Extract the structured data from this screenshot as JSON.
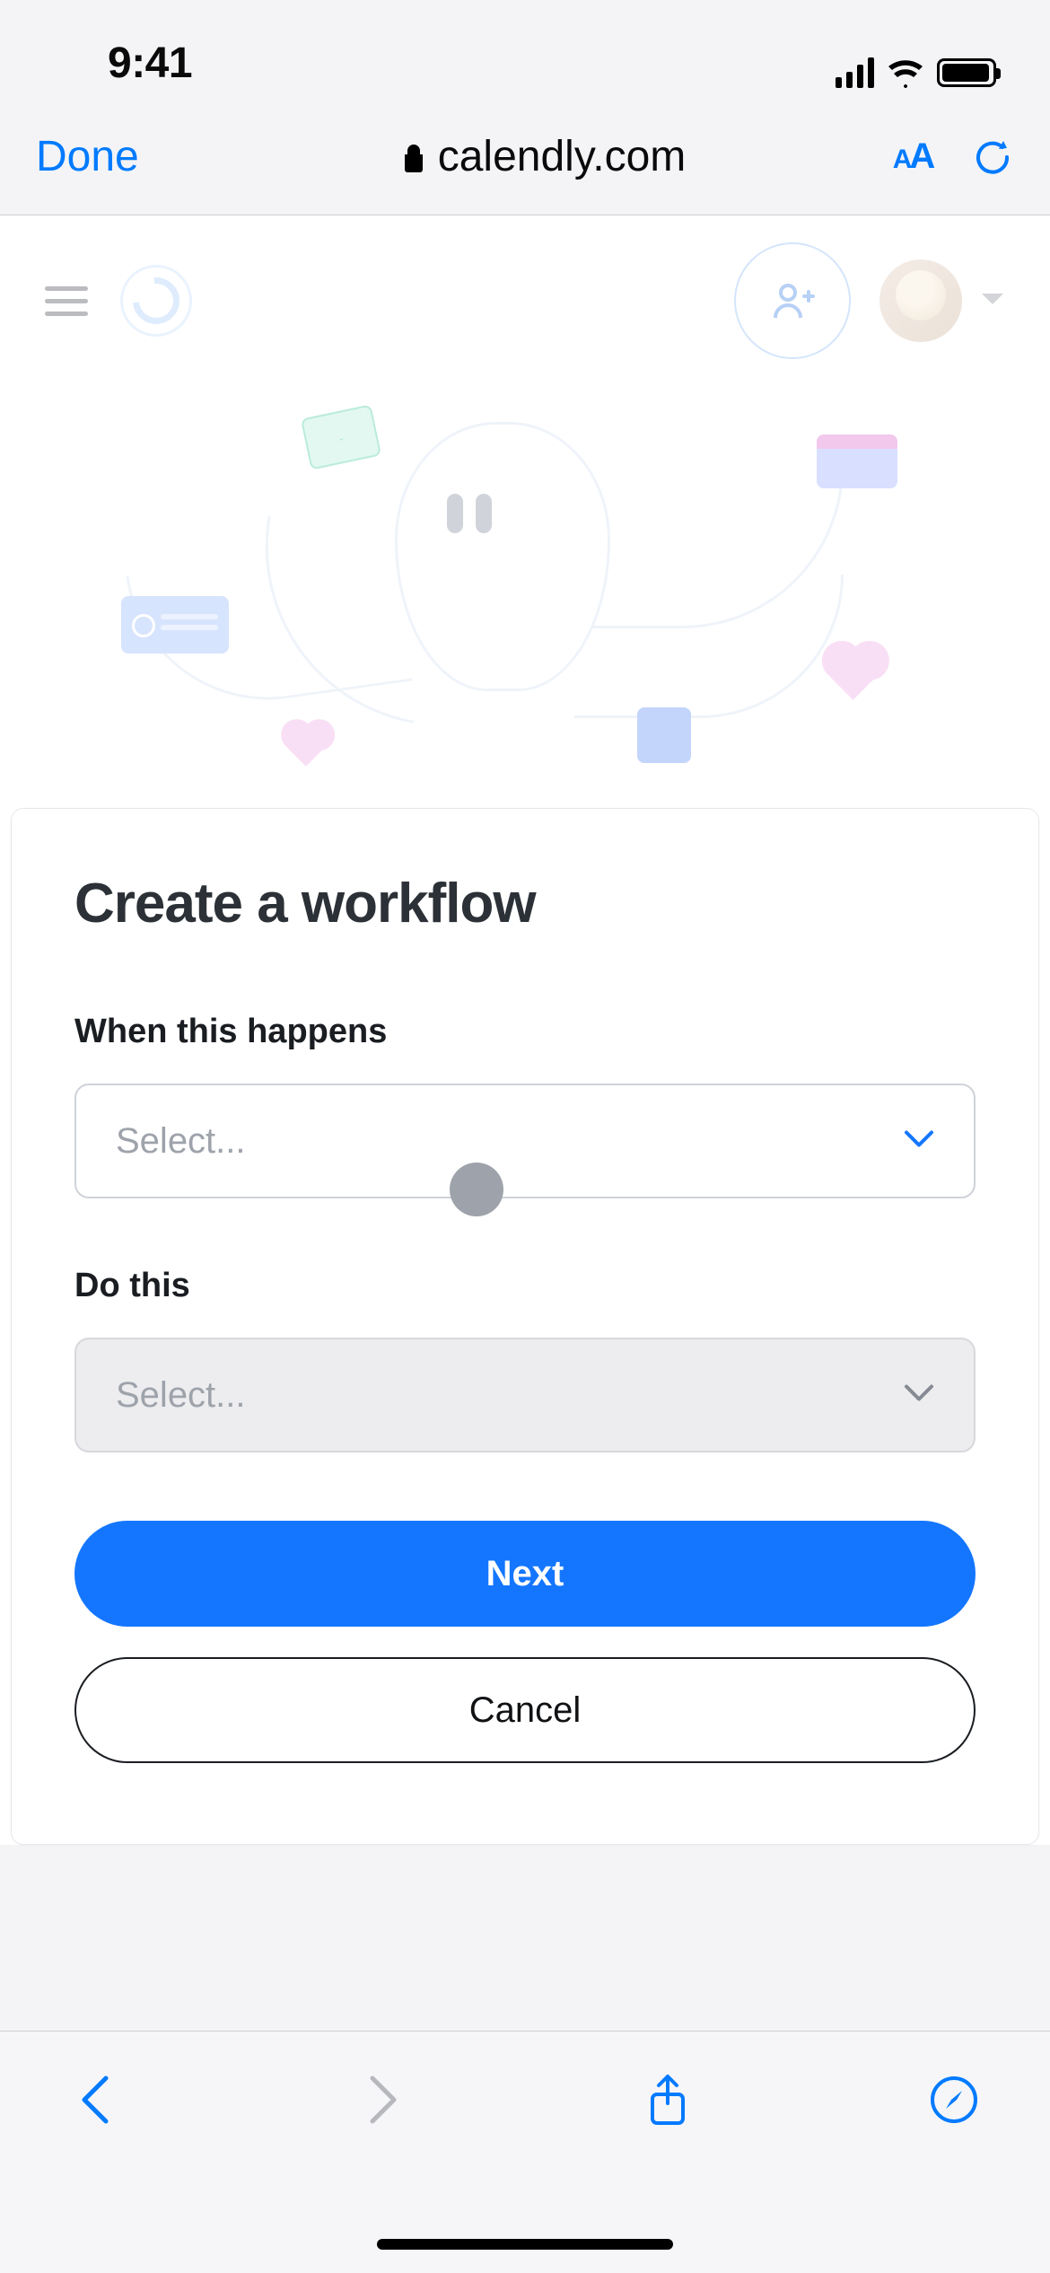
{
  "status": {
    "time": "9:41"
  },
  "browser": {
    "done_label": "Done",
    "url_host": "calendly.com",
    "aa_label_small": "A",
    "aa_label_large": "A"
  },
  "workflow_card": {
    "title": "Create a workflow",
    "trigger_label": "When this happens",
    "trigger_placeholder": "Select...",
    "action_label": "Do this",
    "action_placeholder": "Select...",
    "next_label": "Next",
    "cancel_label": "Cancel"
  },
  "colors": {
    "ios_blue": "#007aff",
    "primary_blue": "#1476ff"
  }
}
